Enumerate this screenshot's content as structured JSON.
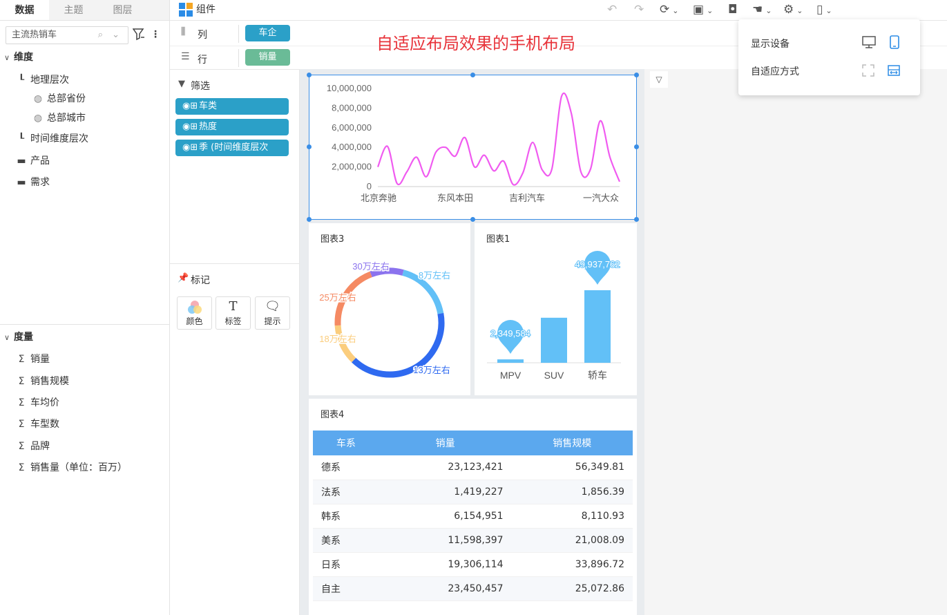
{
  "tabs": [
    {
      "label": "数据"
    },
    {
      "label": "主题"
    },
    {
      "label": "图层"
    }
  ],
  "search": {
    "value": "主流热销车"
  },
  "dimension": {
    "title": "维度",
    "items": [
      {
        "label": "地理层次"
      },
      {
        "label": "总部省份"
      },
      {
        "label": "总部城市"
      },
      {
        "label": "时间维度层次"
      },
      {
        "label": "产品"
      },
      {
        "label": "需求"
      }
    ]
  },
  "measure": {
    "title": "度量",
    "items": [
      {
        "label": "销量"
      },
      {
        "label": "销售规模"
      },
      {
        "label": "车均价"
      },
      {
        "label": "车型数"
      },
      {
        "label": "品牌"
      },
      {
        "label": "销售量（单位：百万）"
      }
    ]
  },
  "toolbar": {
    "component_label": "组件"
  },
  "config": {
    "column_label": "列",
    "column_value": "车企",
    "row_label": "行",
    "row_value": "销量",
    "filter_title": "筛选",
    "filters": [
      {
        "label": "车类"
      },
      {
        "label": "热度"
      },
      {
        "label": "季 (时间维度层次"
      }
    ],
    "mark_title": "标记",
    "marks": [
      {
        "label": "颜色"
      },
      {
        "label": "标签"
      },
      {
        "label": "提示"
      }
    ]
  },
  "annotation": {
    "text": "自适应布局效果的手机布局"
  },
  "popup": {
    "device_label": "显示设备",
    "adapt_label": "自适应方式"
  },
  "colors": {
    "teal": "#2ba0c8",
    "green": "#6abb97",
    "accent": "#3a8ee6",
    "line": "#f05bf0",
    "red": "#e8343b"
  },
  "chart_data": [
    {
      "type": "line",
      "title": "",
      "y_ticks": [
        "10,000,000",
        "8,000,000",
        "6,000,000",
        "4,000,000",
        "2,000,000",
        "0"
      ],
      "ylim": [
        0,
        10000000
      ],
      "x_ticks": [
        "北京奔驰",
        "东风本田",
        "吉利汽车",
        "一汽大众"
      ],
      "values": [
        2000000,
        4100000,
        300000,
        1500000,
        3000000,
        1000000,
        3500000,
        4000000,
        3100000,
        5000000,
        2000000,
        3200000,
        1600000,
        2600000,
        200000,
        1400000,
        4500000,
        1700000,
        1800000,
        9200000,
        7500000,
        1500000,
        1800000,
        6700000,
        3000000,
        500000
      ]
    },
    {
      "type": "pie",
      "title": "图表3",
      "slices": [
        {
          "label": "8万左右",
          "value": 18,
          "color": "#62c0f7"
        },
        {
          "label": "13万左右",
          "value": 40,
          "color": "#2f6af0"
        },
        {
          "label": "18万左右",
          "value": 12,
          "color": "#fbcd7d"
        },
        {
          "label": "25万左右",
          "value": 20,
          "color": "#f58a63"
        },
        {
          "label": "30万左右",
          "value": 10,
          "color": "#8b73ee"
        }
      ]
    },
    {
      "type": "bar",
      "title": "图表1",
      "categories": [
        "MPV",
        "SUV",
        "轿车"
      ],
      "values": [
        2349584,
        31000000,
        49937762
      ],
      "value_labels": [
        "2,349,584",
        "",
        "49,937,762"
      ],
      "color": "#62c0f7"
    },
    {
      "type": "table",
      "title": "图表4",
      "columns": [
        "车系",
        "销量",
        "销售规模"
      ],
      "rows": [
        [
          "德系",
          "23,123,421",
          "56,349.81"
        ],
        [
          "法系",
          "1,419,227",
          "1,856.39"
        ],
        [
          "韩系",
          "6,154,951",
          "8,110.93"
        ],
        [
          "美系",
          "11,598,397",
          "21,008.09"
        ],
        [
          "日系",
          "19,306,114",
          "33,896.72"
        ],
        [
          "自主",
          "23,450,457",
          "25,072.86"
        ]
      ]
    }
  ]
}
